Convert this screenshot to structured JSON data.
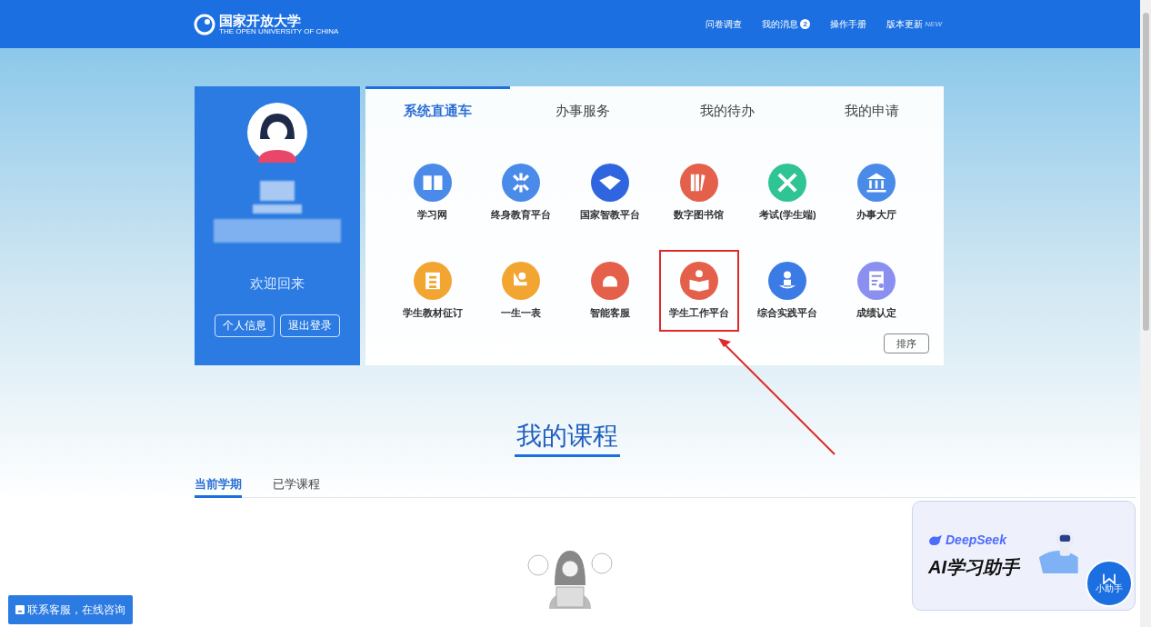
{
  "header": {
    "logo_text": "国家开放大学",
    "logo_subtext": "THE OPEN UNIVERSITY OF CHINA",
    "nav": [
      {
        "label": "问卷调查"
      },
      {
        "label": "我的消息",
        "badge": "2"
      },
      {
        "label": "操作手册"
      },
      {
        "label": "版本更新",
        "tag": "NEW"
      }
    ]
  },
  "profile": {
    "welcome": "欢迎回来",
    "buttons": [
      "个人信息",
      "退出登录"
    ]
  },
  "tabs": [
    {
      "label": "系统直通车",
      "selected": true
    },
    {
      "label": "办事服务",
      "selected": false
    },
    {
      "label": "我的待办",
      "selected": false
    },
    {
      "label": "我的申请",
      "selected": false
    }
  ],
  "apps": [
    {
      "label": "学习网",
      "color": "#4a8ae8",
      "highlighted": false
    },
    {
      "label": "终身教育平台",
      "color": "#4a8ae8",
      "highlighted": false
    },
    {
      "label": "国家智教平台",
      "color": "#2f66e0",
      "highlighted": false
    },
    {
      "label": "数字图书馆",
      "color": "#e5604a",
      "highlighted": false
    },
    {
      "label": "考试(学生端)",
      "color": "#2fc493",
      "highlighted": false
    },
    {
      "label": "办事大厅",
      "color": "#4a8ae8",
      "highlighted": false
    },
    {
      "label": "学生教材征订",
      "color": "#f2a531",
      "highlighted": false
    },
    {
      "label": "一生一表",
      "color": "#f2a531",
      "highlighted": false
    },
    {
      "label": "智能客服",
      "color": "#e5604a",
      "highlighted": false
    },
    {
      "label": "学生工作平台",
      "color": "#e5604a",
      "highlighted": true
    },
    {
      "label": "综合实践平台",
      "color": "#3b7be6",
      "highlighted": false
    },
    {
      "label": "成绩认定",
      "color": "#8a8ff0",
      "highlighted": false
    }
  ],
  "sort_button": "排序",
  "courses": {
    "title": "我的课程",
    "tabs": [
      {
        "label": "当前学期",
        "selected": true
      },
      {
        "label": "已学课程",
        "selected": false
      }
    ]
  },
  "contact_button": "联系客服，在线咨询",
  "assistant": {
    "brand": "DeepSeek",
    "title": "AI学习助手",
    "badge": "小助手"
  }
}
